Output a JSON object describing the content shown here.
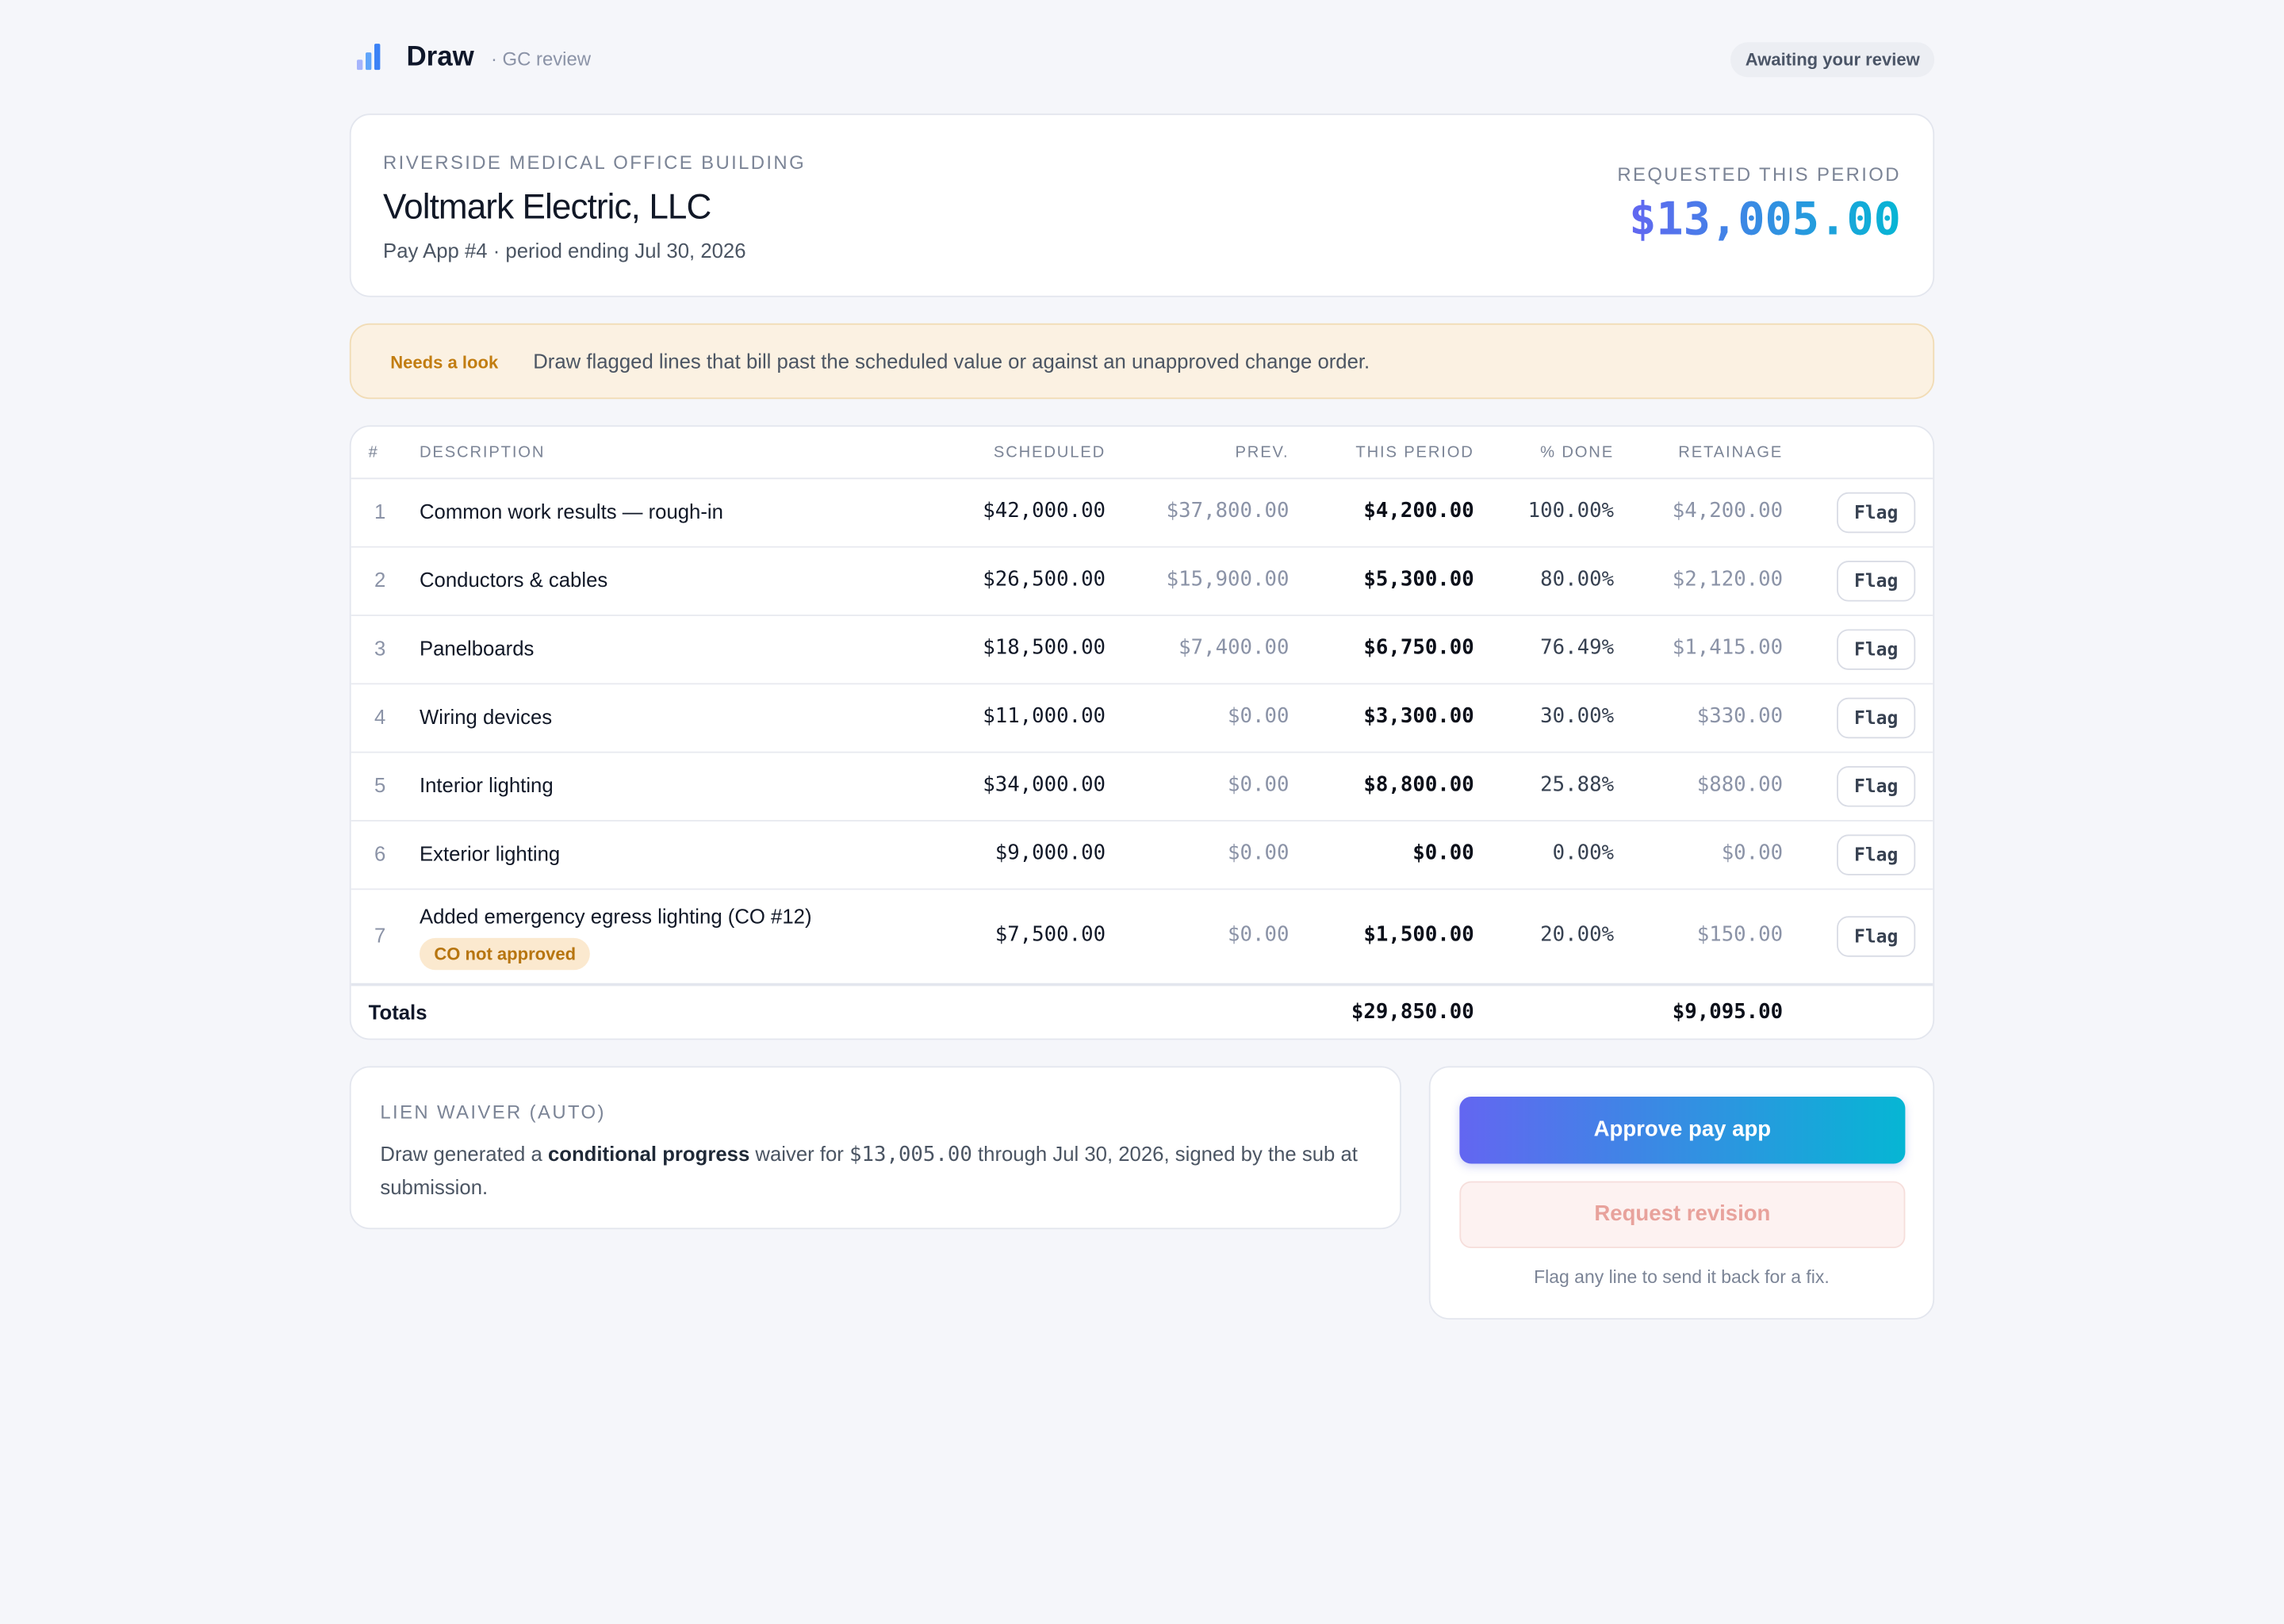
{
  "header": {
    "brand": "Draw",
    "crumb": "· GC review",
    "status": "Awaiting your review",
    "logo_colors": [
      "#a5b4fc",
      "#60a5fa",
      "#3b82f6"
    ]
  },
  "project": {
    "name": "RIVERSIDE MEDICAL OFFICE BUILDING",
    "subcontractor": "Voltmark Electric, LLC",
    "pay_app": "Pay App #4 · period ending Jul 30, 2026",
    "requested_label": "REQUESTED THIS PERIOD",
    "requested_amount": "$13,005.00"
  },
  "alert": {
    "tag": "Needs a look",
    "message": "Draw flagged lines that bill past the scheduled value or against an unapproved change order."
  },
  "table": {
    "columns": [
      "#",
      "DESCRIPTION",
      "SCHEDULED",
      "PREV.",
      "THIS PERIOD",
      "% DONE",
      "RETAINAGE"
    ],
    "flag_label": "Flag",
    "rows": [
      {
        "num": "1",
        "desc": "Common work results — rough-in",
        "scheduled": "$42,000.00",
        "prev": "$37,800.00",
        "this_period": "$4,200.00",
        "pct": "100.00%",
        "retainage": "$4,200.00"
      },
      {
        "num": "2",
        "desc": "Conductors & cables",
        "scheduled": "$26,500.00",
        "prev": "$15,900.00",
        "this_period": "$5,300.00",
        "pct": "80.00%",
        "retainage": "$2,120.00"
      },
      {
        "num": "3",
        "desc": "Panelboards",
        "scheduled": "$18,500.00",
        "prev": "$7,400.00",
        "this_period": "$6,750.00",
        "pct": "76.49%",
        "retainage": "$1,415.00"
      },
      {
        "num": "4",
        "desc": "Wiring devices",
        "scheduled": "$11,000.00",
        "prev": "$0.00",
        "this_period": "$3,300.00",
        "pct": "30.00%",
        "retainage": "$330.00"
      },
      {
        "num": "5",
        "desc": "Interior lighting",
        "scheduled": "$34,000.00",
        "prev": "$0.00",
        "this_period": "$8,800.00",
        "pct": "25.88%",
        "retainage": "$880.00"
      },
      {
        "num": "6",
        "desc": "Exterior lighting",
        "scheduled": "$9,000.00",
        "prev": "$0.00",
        "this_period": "$0.00",
        "pct": "0.00%",
        "retainage": "$0.00"
      },
      {
        "num": "7",
        "desc": "Added emergency egress lighting (CO #12)",
        "badge": "CO not approved",
        "scheduled": "$7,500.00",
        "prev": "$0.00",
        "this_period": "$1,500.00",
        "pct": "20.00%",
        "retainage": "$150.00"
      }
    ],
    "totals": {
      "label": "Totals",
      "this_period": "$29,850.00",
      "retainage": "$9,095.00"
    }
  },
  "lien": {
    "title": "LIEN WAIVER (AUTO)",
    "text_1": "Draw generated a ",
    "text_bold": "conditional progress",
    "text_2": " waiver for ",
    "amount": "$13,005.00",
    "text_3": " through Jul 30, 2026, signed by the sub at submission."
  },
  "actions": {
    "approve": "Approve pay app",
    "revise": "Request revision",
    "hint": "Flag any line to send it back for a fix."
  }
}
